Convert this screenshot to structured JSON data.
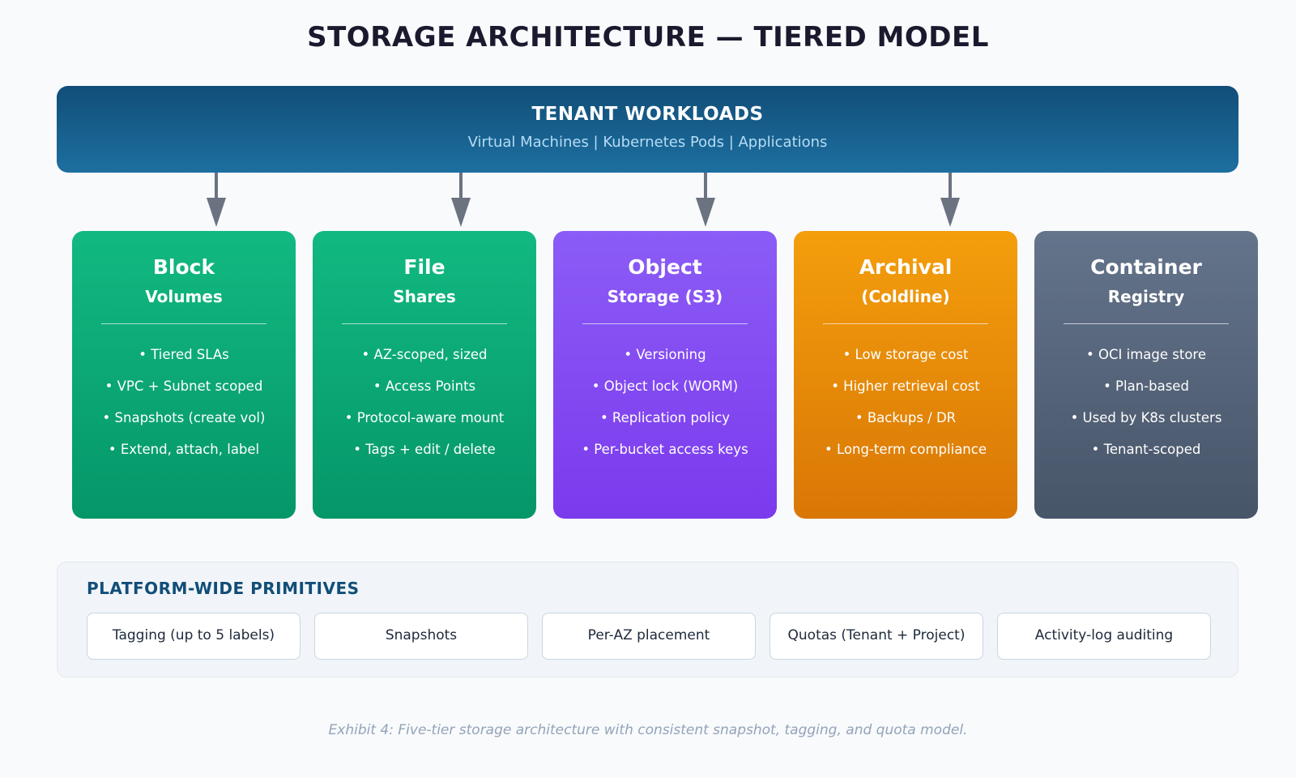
{
  "title": "STORAGE ARCHITECTURE — TIERED MODEL",
  "top_band": {
    "title": "TENANT WORKLOADS",
    "subtitle": "Virtual Machines | Kubernetes Pods | Applications"
  },
  "arrow_color": "#6b7280",
  "tiers": [
    {
      "title": "Block",
      "subtitle": "Volumes",
      "color": "#10b981",
      "bullets": [
        "• Tiered SLAs",
        "• VPC + Subnet scoped",
        "• Snapshots (create vol)",
        "• Extend, attach, label"
      ]
    },
    {
      "title": "File",
      "subtitle": "Shares",
      "color": "#10b981",
      "bullets": [
        "• AZ-scoped, sized",
        "• Access Points",
        "• Protocol-aware mount",
        "• Tags + edit / delete"
      ]
    },
    {
      "title": "Object",
      "subtitle": "Storage (S3)",
      "color": "#8b5cf6",
      "bullets": [
        "• Versioning",
        "• Object lock (WORM)",
        "• Replication policy",
        "• Per-bucket access keys"
      ]
    },
    {
      "title": "Archival",
      "subtitle": "(Coldline)",
      "color": "#f59e0b",
      "bullets": [
        "• Low storage cost",
        "• Higher retrieval cost",
        "• Backups / DR",
        "• Long-term compliance"
      ]
    },
    {
      "title": "Container",
      "subtitle": "Registry",
      "color": "#64748b",
      "bullets": [
        "• OCI image store",
        "• Plan-based",
        "• Used by K8s clusters",
        "• Tenant-scoped"
      ]
    }
  ],
  "platform": {
    "title": "PLATFORM-WIDE PRIMITIVES",
    "primitives": [
      "Tagging (up to 5 labels)",
      "Snapshots",
      "Per-AZ placement",
      "Quotas (Tenant + Project)",
      "Activity-log auditing"
    ]
  },
  "caption": "Exhibit 4: Five-tier storage architecture with consistent snapshot, tagging, and quota model."
}
